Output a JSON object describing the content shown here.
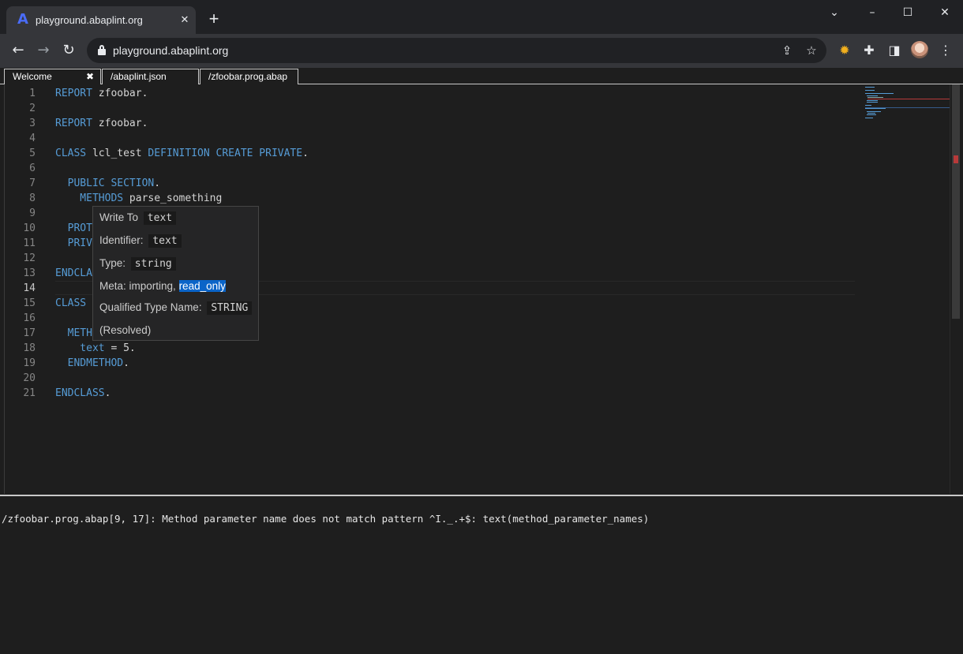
{
  "browser": {
    "tab_title": "playground.abaplint.org",
    "tab_favicon": "A",
    "url": "playground.abaplint.org",
    "new_tab_label": "+"
  },
  "icons": {
    "favicon": "abaplint-logo-icon",
    "back": "back-arrow-icon",
    "forward": "forward-arrow-icon",
    "reload": "reload-icon",
    "lock": "lock-icon",
    "share": "share-icon",
    "star": "star-icon",
    "extension": "extension-icon",
    "puzzle": "puzzle-icon",
    "sidepanel": "sidepanel-icon",
    "menu": "kebab-menu-icon"
  },
  "editor_tabs": [
    {
      "label": "Welcome",
      "close": "✖"
    },
    {
      "label": "/abaplint.json"
    },
    {
      "label": "/zfoobar.prog.abap"
    }
  ],
  "code": [
    {
      "n": "1",
      "tokens": [
        {
          "t": "REPORT",
          "k": "kw"
        },
        {
          "t": " zfoobar.",
          "k": "id"
        }
      ]
    },
    {
      "n": "2",
      "tokens": []
    },
    {
      "n": "3",
      "tokens": [
        {
          "t": "REPORT",
          "k": "kw"
        },
        {
          "t": " zfoobar.",
          "k": "id"
        }
      ]
    },
    {
      "n": "4",
      "tokens": []
    },
    {
      "n": "5",
      "tokens": [
        {
          "t": "CLASS",
          "k": "kw"
        },
        {
          "t": " lcl_test ",
          "k": "id"
        },
        {
          "t": "DEFINITION CREATE PRIVATE",
          "k": "kw"
        },
        {
          "t": ".",
          "k": "id"
        }
      ]
    },
    {
      "n": "6",
      "tokens": []
    },
    {
      "n": "7",
      "tokens": [
        {
          "t": "  PUBLIC SECTION",
          "k": "kw"
        },
        {
          "t": ".",
          "k": "id"
        }
      ]
    },
    {
      "n": "8",
      "tokens": [
        {
          "t": "    METHODS",
          "k": "kw"
        },
        {
          "t": " parse_something",
          "k": "id"
        }
      ]
    },
    {
      "n": "9",
      "tokens": []
    },
    {
      "n": "10",
      "tokens": [
        {
          "t": "  PROT",
          "k": "kw"
        }
      ]
    },
    {
      "n": "11",
      "tokens": [
        {
          "t": "  PRIV",
          "k": "kw"
        }
      ]
    },
    {
      "n": "12",
      "tokens": []
    },
    {
      "n": "13",
      "tokens": [
        {
          "t": "ENDCLA",
          "k": "kw"
        }
      ]
    },
    {
      "n": "14",
      "tokens": [],
      "current": true
    },
    {
      "n": "15",
      "tokens": [
        {
          "t": "CLASS",
          "k": "kw"
        }
      ]
    },
    {
      "n": "16",
      "tokens": []
    },
    {
      "n": "17",
      "tokens": [
        {
          "t": "  METH",
          "k": "kw"
        }
      ]
    },
    {
      "n": "18",
      "tokens": [
        {
          "t": "    text",
          "k": "kw"
        },
        {
          "t": " = 5.",
          "k": "id"
        }
      ]
    },
    {
      "n": "19",
      "tokens": [
        {
          "t": "  ENDMETHOD",
          "k": "kw"
        },
        {
          "t": ".",
          "k": "id"
        }
      ]
    },
    {
      "n": "20",
      "tokens": []
    },
    {
      "n": "21",
      "tokens": [
        {
          "t": "ENDCLASS",
          "k": "kw"
        },
        {
          "t": ".",
          "k": "id"
        }
      ]
    }
  ],
  "hover": {
    "write_to_label": "Write To",
    "write_to_value": "text",
    "identifier_label": "Identifier:",
    "identifier_value": "text",
    "type_label": "Type:",
    "type_value": "string",
    "meta_label": "Meta: importing,",
    "meta_selected": "read_only",
    "qualified_label": "Qualified Type Name:",
    "qualified_value": "STRING",
    "resolved": "(Resolved)"
  },
  "problems": {
    "message": "/zfoobar.prog.abap[9, 17]: Method parameter name does not match pattern ^I._.+$: text(method_parameter_names)"
  },
  "colors": {
    "keyword": "#569cd6",
    "identifier": "#d4d4d4",
    "selection": "#0a64c8",
    "error_marker": "#b83a3a"
  }
}
